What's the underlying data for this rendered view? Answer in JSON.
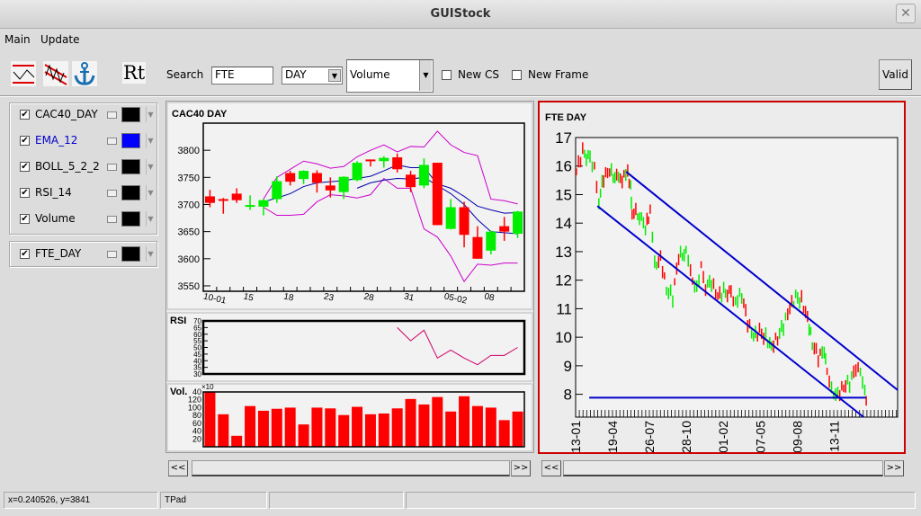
{
  "window": {
    "title": "GUIStock",
    "close_icon": "close-x"
  },
  "menu": {
    "main": "Main",
    "update": "Update"
  },
  "toolbar": {
    "icons": [
      "trend-line-icon",
      "channel-icon",
      "anchor-icon"
    ],
    "rt_label": "Rt",
    "search_label": "Search",
    "search_value": "FTE",
    "period_value": "DAY",
    "indicator_value": "Volume",
    "new_cs_label": "New CS",
    "new_frame_label": "New Frame",
    "valid_label": "Valid"
  },
  "series_panel": {
    "items": [
      {
        "name": "CAC40_DAY",
        "checked": true,
        "color": "#000000",
        "text_color": "#000000"
      },
      {
        "name": "EMA_12",
        "checked": true,
        "color": "#0000ff",
        "text_color": "#0000cc"
      },
      {
        "name": "BOLL_5_2_2",
        "checked": true,
        "color": "#000000",
        "text_color": "#000000"
      },
      {
        "name": "RSI_14",
        "checked": true,
        "color": "#000000",
        "text_color": "#000000"
      },
      {
        "name": "Volume",
        "checked": true,
        "color": "#000000",
        "text_color": "#000000"
      }
    ],
    "items2": [
      {
        "name": "FTE_DAY",
        "checked": true,
        "color": "#000000",
        "text_color": "#000000"
      }
    ]
  },
  "scroll": {
    "left": "<<",
    "right": ">>"
  },
  "status": {
    "coords": "x=0.240526, y=3841",
    "object": "TPad",
    "field3": "",
    "field4": ""
  },
  "colors": {
    "up": "#00ee00",
    "down": "#ff0000",
    "ema": "#0000aa",
    "boll": "#cc00cc",
    "rsi": "#cc0066",
    "trend": "#0000cc",
    "active_frame": "#cc0000"
  },
  "chart_data": [
    {
      "type": "candlestick",
      "title": "CAC40 DAY",
      "ylim": [
        3540,
        3850
      ],
      "yticks": [
        3550,
        3600,
        3650,
        3700,
        3750,
        3800
      ],
      "xtick_labels": [
        {
          "i": 0,
          "label": "10-01"
        },
        {
          "i": 3,
          "label": "15"
        },
        {
          "i": 6,
          "label": "18"
        },
        {
          "i": 9,
          "label": "23"
        },
        {
          "i": 12,
          "label": "28"
        },
        {
          "i": 15,
          "label": "31"
        },
        {
          "i": 18,
          "label": "05-02"
        },
        {
          "i": 21,
          "label": "08"
        }
      ],
      "ohlc": [
        [
          3715,
          3727,
          3695,
          3703
        ],
        [
          3710,
          3712,
          3683,
          3708
        ],
        [
          3720,
          3730,
          3703,
          3708
        ],
        [
          3698,
          3717,
          3690,
          3699
        ],
        [
          3696,
          3710,
          3680,
          3708
        ],
        [
          3710,
          3752,
          3703,
          3743
        ],
        [
          3758,
          3762,
          3735,
          3742
        ],
        [
          3747,
          3763,
          3738,
          3762
        ],
        [
          3758,
          3763,
          3722,
          3740
        ],
        [
          3735,
          3750,
          3713,
          3726
        ],
        [
          3723,
          3752,
          3710,
          3751
        ],
        [
          3745,
          3780,
          3743,
          3777
        ],
        [
          3783,
          3783,
          3770,
          3781
        ],
        [
          3780,
          3789,
          3768,
          3786
        ],
        [
          3787,
          3794,
          3759,
          3765
        ],
        [
          3755,
          3762,
          3723,
          3732
        ],
        [
          3735,
          3785,
          3730,
          3773
        ],
        [
          3777,
          3777,
          3662,
          3662
        ],
        [
          3655,
          3710,
          3654,
          3695
        ],
        [
          3695,
          3705,
          3621,
          3644
        ],
        [
          3640,
          3660,
          3600,
          3600
        ],
        [
          3615,
          3652,
          3608,
          3650
        ],
        [
          3660,
          3677,
          3633,
          3650
        ],
        [
          3646,
          3688,
          3638,
          3687
        ]
      ],
      "ema_12": {
        "start": 4,
        "values": [
          3705,
          3712,
          3720,
          3733,
          3740,
          3742,
          3744,
          3748,
          3752,
          3762,
          3773,
          3768,
          3768,
          3738,
          3730,
          3715,
          3697,
          3690,
          3684,
          3685
        ]
      },
      "boll_mid": {
        "start": 11,
        "values": [
          3730,
          3740,
          3745,
          3748,
          3747,
          3750,
          3735,
          3720,
          3700,
          3672,
          3650,
          3648,
          3646
        ]
      },
      "boll_upper": {
        "start": 4,
        "values": [
          3710,
          3750,
          3765,
          3780,
          3775,
          3767,
          3770,
          3788,
          3800,
          3810,
          3797,
          3807,
          3806,
          3835,
          3810,
          3796,
          3790,
          3710,
          3707,
          3701
        ]
      },
      "boll_lower": {
        "start": 4,
        "values": [
          3695,
          3680,
          3680,
          3682,
          3705,
          3718,
          3716,
          3712,
          3718,
          3748,
          3730,
          3730,
          3655,
          3640,
          3605,
          3558,
          3590,
          3588,
          3592,
          3592
        ]
      }
    },
    {
      "type": "line",
      "title": "RSI",
      "ylim": [
        30,
        70
      ],
      "yticks": [
        30,
        35,
        40,
        45,
        50,
        55,
        60,
        65,
        70
      ],
      "start": 14,
      "values": [
        65,
        55,
        63,
        42,
        48,
        42,
        37,
        44,
        44,
        50
      ]
    },
    {
      "type": "bar",
      "title": "Vol.",
      "multiplier": "×10",
      "ylim": [
        0,
        140
      ],
      "ytick_labels": [
        {
          "v": 20,
          "label": "20"
        },
        {
          "v": 40,
          "label": "40"
        },
        {
          "v": 60,
          "label": "60"
        },
        {
          "v": 80,
          "label": "80"
        },
        {
          "v": 100,
          "label": "100"
        },
        {
          "v": 120,
          "label": "120"
        },
        {
          "v": 140,
          "label": "40"
        }
      ],
      "values": [
        140,
        83,
        28,
        104,
        92,
        97,
        100,
        57,
        100,
        98,
        81,
        102,
        83,
        85,
        98,
        122,
        108,
        127,
        90,
        129,
        104,
        100,
        68,
        90
      ]
    },
    {
      "type": "candlestick",
      "title": "FTE DAY",
      "ylim": [
        7.2,
        17
      ],
      "yticks": [
        8,
        9,
        10,
        11,
        12,
        13,
        14,
        15,
        16,
        17
      ],
      "xtick_labels": [
        "13-01",
        "19-04",
        "26-07",
        "28-10",
        "01-02",
        "07-05",
        "09-08",
        "13-11"
      ],
      "xlim_ticks": [
        0,
        8.72
      ],
      "price_path": [
        [
          0.02,
          15.8
        ],
        [
          0.19,
          16.5
        ],
        [
          0.39,
          16.2
        ],
        [
          0.51,
          16.0
        ],
        [
          0.63,
          14.8
        ],
        [
          0.76,
          15.6
        ],
        [
          0.92,
          15.8
        ],
        [
          1.16,
          15.5
        ],
        [
          1.41,
          15.7
        ],
        [
          1.49,
          15.3
        ],
        [
          1.53,
          14.4
        ],
        [
          1.73,
          14.3
        ],
        [
          1.89,
          13.8
        ],
        [
          2.02,
          14.4
        ],
        [
          2.14,
          12.5
        ],
        [
          2.3,
          12.8
        ],
        [
          2.46,
          11.7
        ],
        [
          2.63,
          11.4
        ],
        [
          2.79,
          12.8
        ],
        [
          2.99,
          13.0
        ],
        [
          3.11,
          12.2
        ],
        [
          3.28,
          11.7
        ],
        [
          3.4,
          12.6
        ],
        [
          3.52,
          11.8
        ],
        [
          3.68,
          11.9
        ],
        [
          3.85,
          11.4
        ],
        [
          4.01,
          11.6
        ],
        [
          4.21,
          11.5
        ],
        [
          4.33,
          11.3
        ],
        [
          4.5,
          11.5
        ],
        [
          4.66,
          10.5
        ],
        [
          4.82,
          10.0
        ],
        [
          4.98,
          10.2
        ],
        [
          5.15,
          10.0
        ],
        [
          5.31,
          9.7
        ],
        [
          5.47,
          10.0
        ],
        [
          5.63,
          10.4
        ],
        [
          5.8,
          11.0
        ],
        [
          5.96,
          11.4
        ],
        [
          6.12,
          11.3
        ],
        [
          6.28,
          10.7
        ],
        [
          6.41,
          9.8
        ],
        [
          6.57,
          9.3
        ],
        [
          6.73,
          9.5
        ],
        [
          6.81,
          8.7
        ],
        [
          6.93,
          8.1
        ],
        [
          7.1,
          8.0
        ],
        [
          7.26,
          8.3
        ],
        [
          7.42,
          8.4
        ],
        [
          7.59,
          8.9
        ],
        [
          7.71,
          8.7
        ],
        [
          7.83,
          8.0
        ],
        [
          7.91,
          7.7
        ]
      ],
      "trend_lines": [
        [
          [
            1.37,
            15.8
          ],
          [
            8.72,
            8.15
          ]
        ],
        [
          [
            0.59,
            14.6
          ],
          [
            7.8,
            7.2
          ]
        ],
        [
          [
            0.37,
            7.88
          ],
          [
            7.86,
            7.88
          ]
        ]
      ]
    }
  ]
}
